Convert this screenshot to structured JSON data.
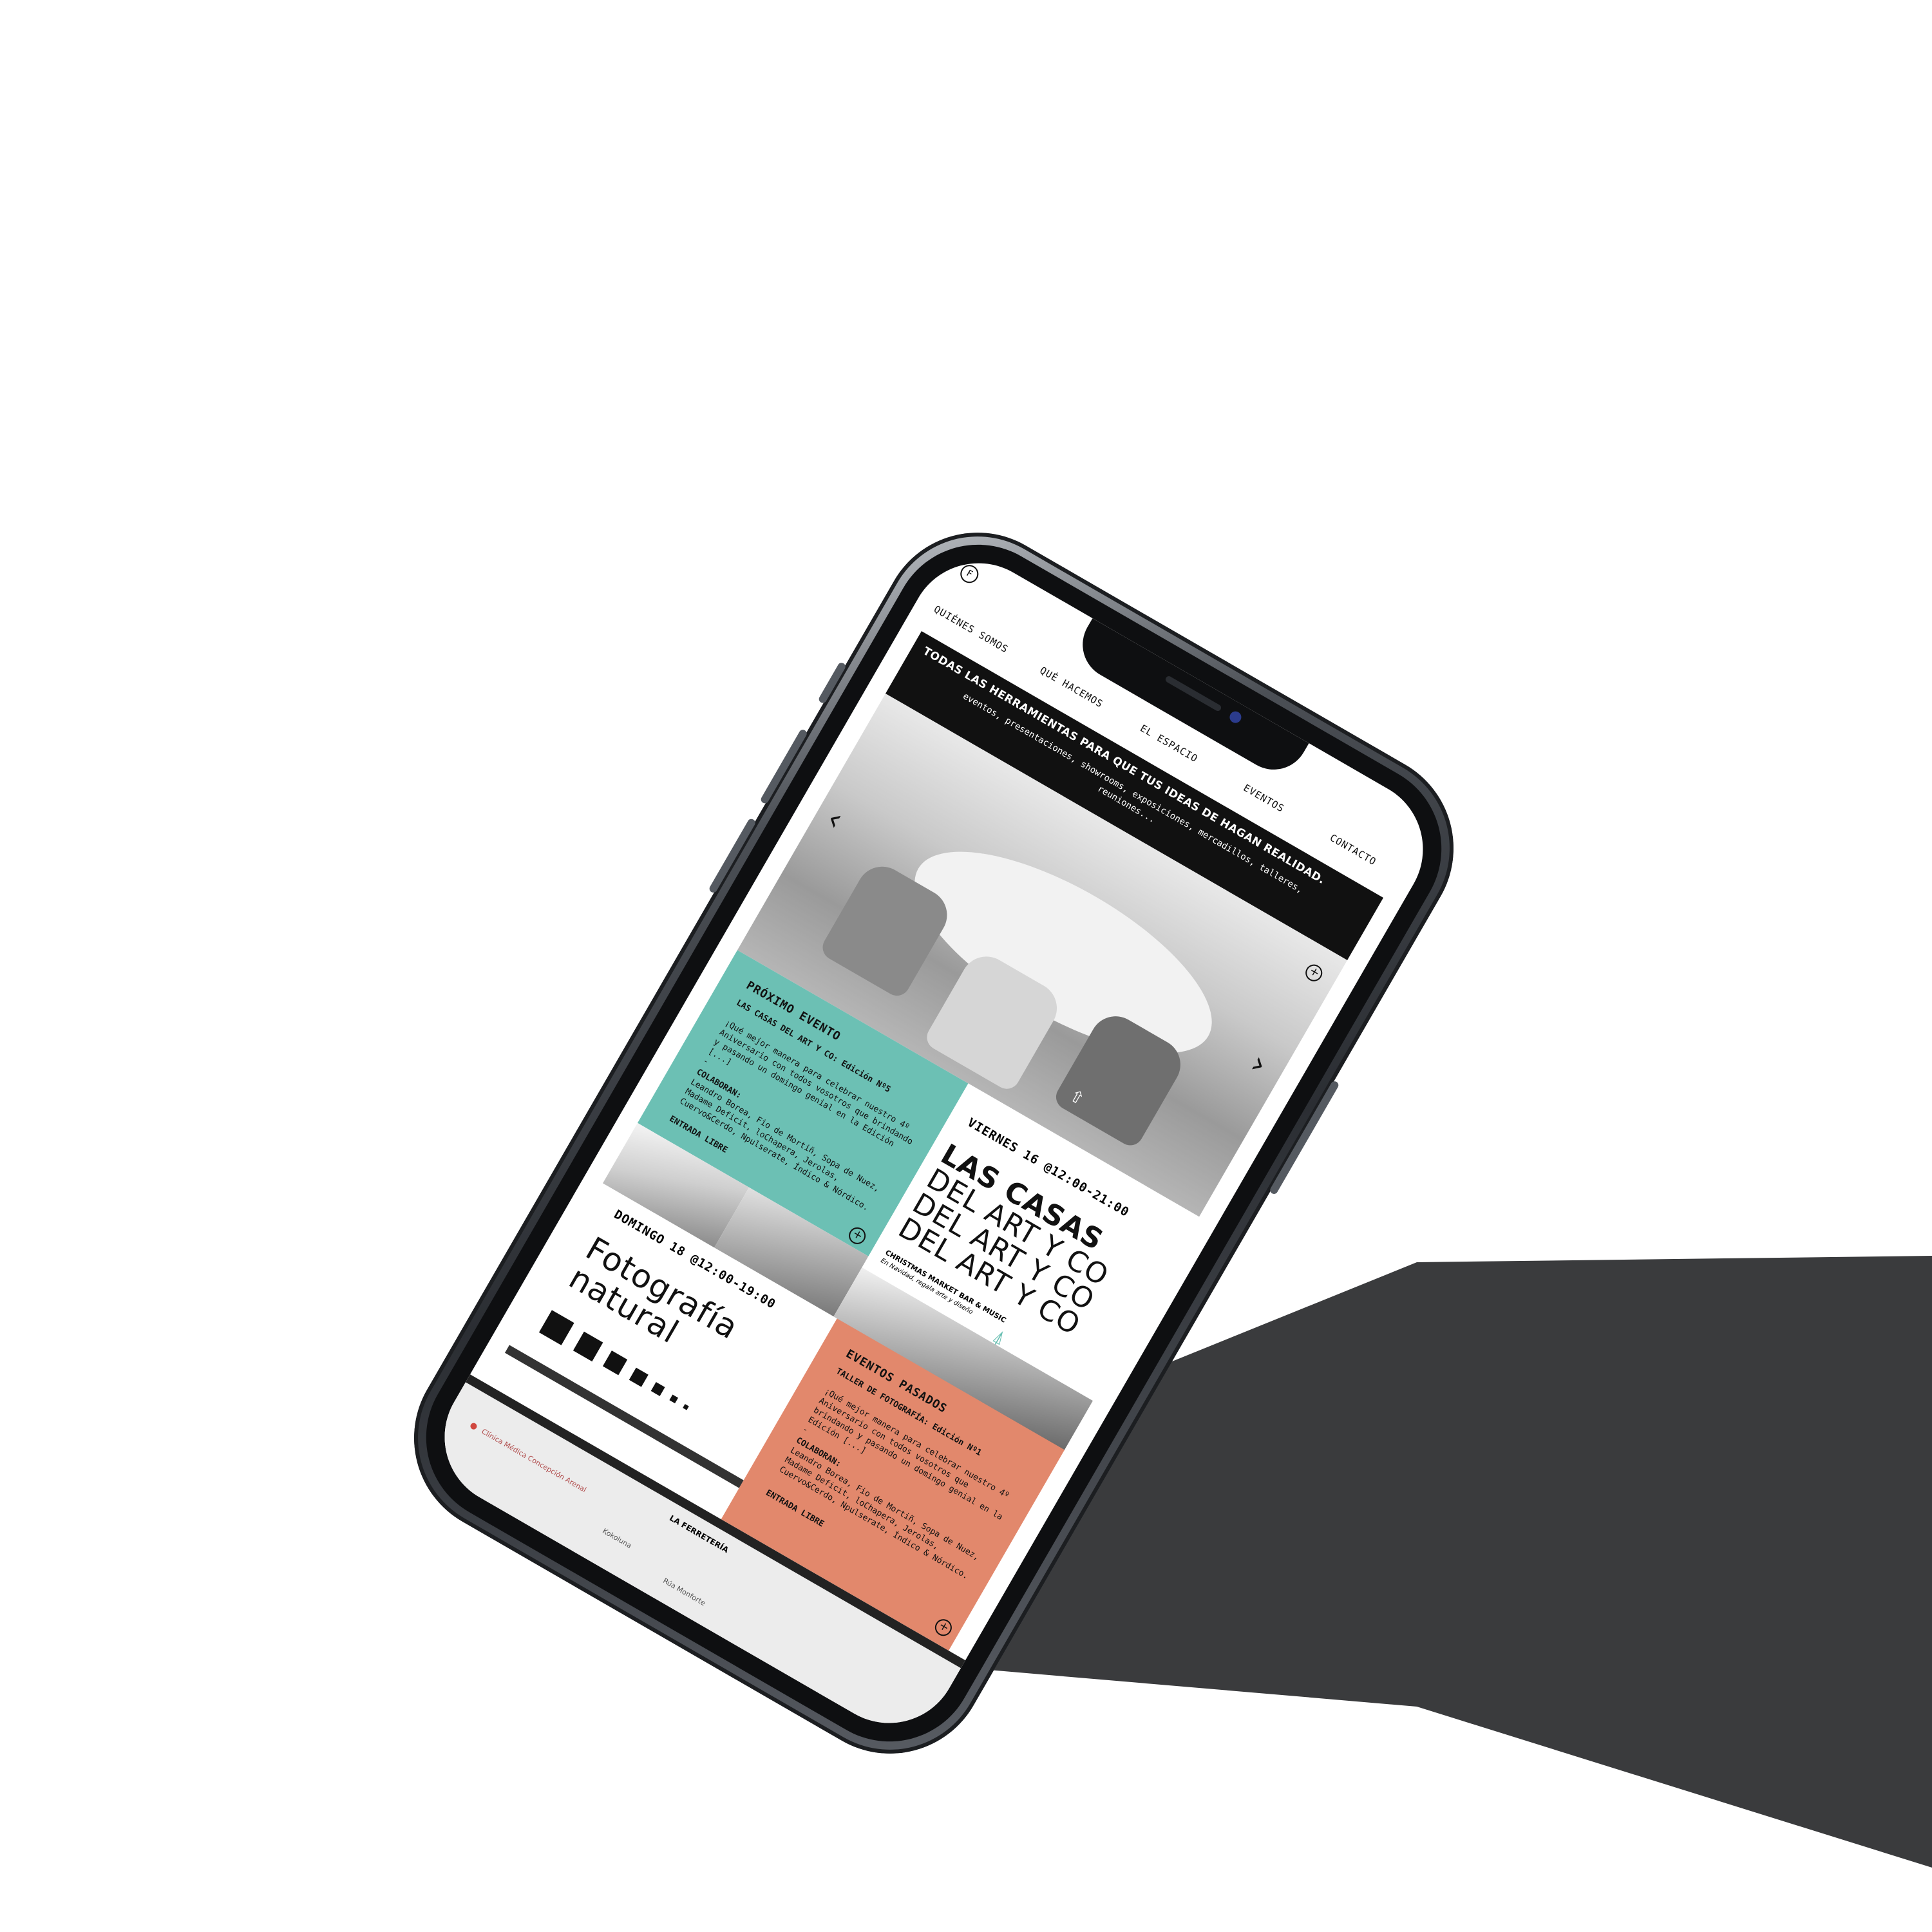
{
  "nav": {
    "items": [
      "QUIÉNES SOMOS",
      "QUÉ HACEMOS",
      "EL ESPACIO",
      "EVENTOS",
      "CONTACTO"
    ]
  },
  "banner": {
    "headline": "TODAS LAS HERRAMIENTAS PARA QUE TUS IDEAS DE HAGAN REALIDAD.",
    "subline": "eventos, presentaciones, showrooms, exposiciones, mercadillos, talleres, reuniones..."
  },
  "next_event": {
    "section_label": "PRÓXIMO EVENTO",
    "title": "LAS CASAS DEL ART Y CO: Edición Nº5",
    "description": "¡Qué mejor manera para celebrar nuestro 4º Aniversario con todos vosotros que brindando y pasando un domingo genial en la Edición [...]",
    "dash": "-",
    "collab_label": "COLABORAN:",
    "collaborators": "Leandro Borea, Fio de Mortiñ, Sopa de Nuez, Madame Deficit, loChapera, Jerolas, Cuervo&Cerdo, Npulserate, Índico & Nórdico.",
    "entry": "ENTRADA LIBRE",
    "date": "VIERNES 16 @12:00-21:00",
    "big_line_1": "LAS CASAS",
    "big_line_2": "DEL ART Y CO",
    "big_line_3": "DEL ART Y CO",
    "big_line_4": "DEL ART Y CO",
    "caption": "CHRISTMAS MARKET BAR & MUSIC",
    "caption_sub": "En Navidad, regala arte y diseño"
  },
  "second_event": {
    "date": "DOMINGO 18 @12:00-19:00",
    "title_line_1": "Fotografía",
    "title_line_2": "natural"
  },
  "past_events": {
    "section_label": "EVENTOS PASADOS",
    "title": "TALLER DE FOTOGRAFÍA: Edición Nº1",
    "description": "¡Qué mejor manera para celebrar nuestro 4º Aniversario con todos vosotros que brindando y pasando un domingo genial en la Edición [...]",
    "dash": "-",
    "collab_label": "COLABORAN:",
    "collaborators": "Leandro Borea, Fio de Mortiñ, Sopa de Nuez, Madame Deficit, loChapera, Jerolas, Cuervo&Cerdo, Npulserate, Índico & Nórdico.",
    "entry": "ENTRADA LIBRE"
  },
  "footer": {
    "venue": "LA FERRETERÍA",
    "map_labels": [
      "Clínica Médica Concepción Arenal",
      "Kokoluna",
      "Rúa Monforte"
    ]
  },
  "colors": {
    "teal": "#6cc0b4",
    "salmon": "#e2886c",
    "black": "#111111",
    "shadow": "#3a3b3d"
  }
}
